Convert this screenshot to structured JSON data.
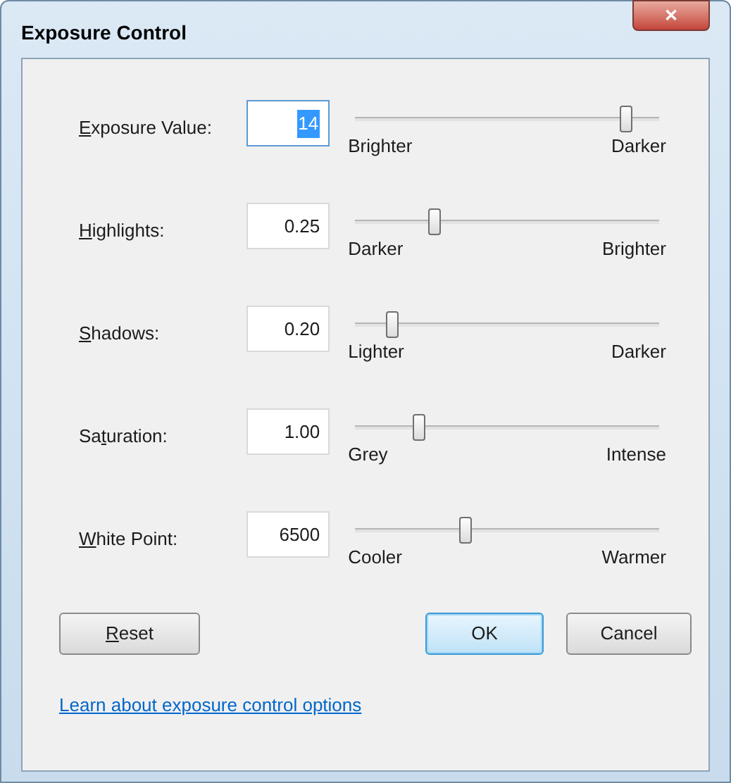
{
  "window": {
    "title": "Exposure Control",
    "close_label": "✕"
  },
  "controls": [
    {
      "label": {
        "key": "E",
        "after": "xposure Value:"
      },
      "value": "14",
      "focused": true,
      "level": 0.89,
      "min_label": "Brighter",
      "max_label": "Darker"
    },
    {
      "label": {
        "key": "H",
        "after": "ighlights:"
      },
      "value": "0.25",
      "focused": false,
      "level": 0.26,
      "min_label": "Darker",
      "max_label": "Brighter"
    },
    {
      "label": {
        "key": "S",
        "after": "hadows:"
      },
      "value": "0.20",
      "focused": false,
      "level": 0.12,
      "min_label": "Lighter",
      "max_label": "Darker"
    },
    {
      "label": {
        "before": "Sa",
        "key": "t",
        "after": "uration:"
      },
      "value": "1.00",
      "focused": false,
      "level": 0.21,
      "min_label": "Grey",
      "max_label": "Intense"
    },
    {
      "label": {
        "key": "W",
        "after": "hite Point:"
      },
      "value": "6500",
      "focused": false,
      "level": 0.36,
      "min_label": "Cooler",
      "max_label": "Warmer"
    }
  ],
  "buttons": [
    {
      "label": {
        "key": "R",
        "after": "eset"
      },
      "default": false
    },
    {
      "label": {
        "before": "OK"
      },
      "default": true
    },
    {
      "label": {
        "before": "Cancel"
      },
      "default": false
    }
  ],
  "link": "Learn about exposure control options"
}
